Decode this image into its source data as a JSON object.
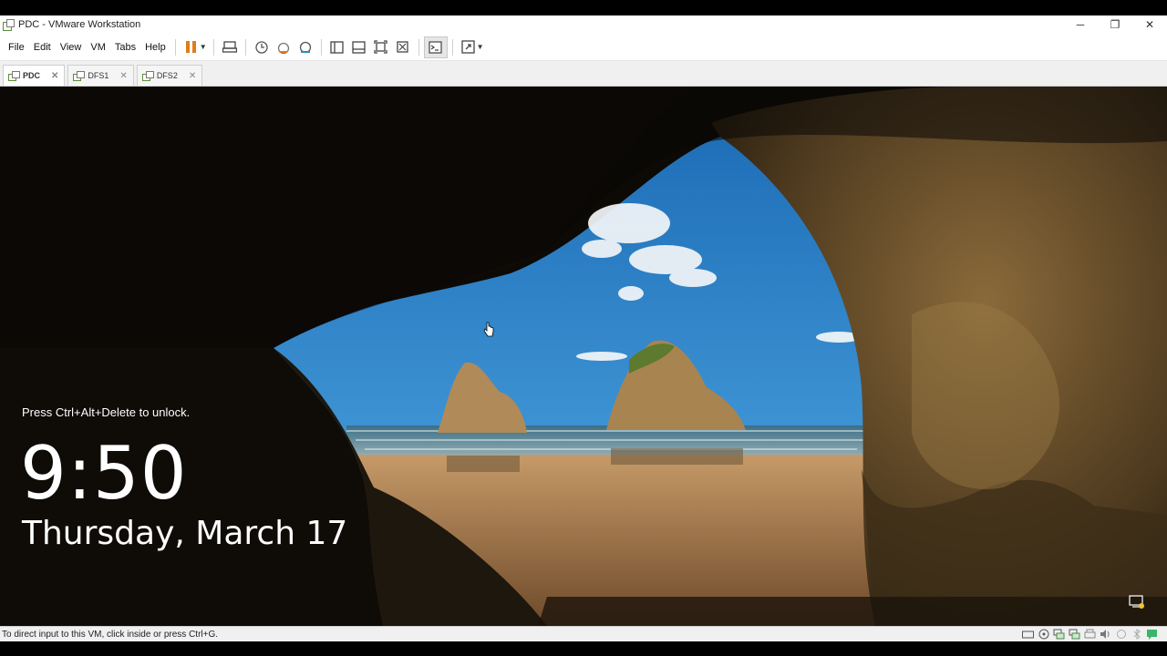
{
  "window": {
    "title": "PDC - VMware Workstation",
    "controls": {
      "minimize": "─",
      "restore": "❐",
      "close": "✕"
    }
  },
  "menu": {
    "items": [
      "File",
      "Edit",
      "View",
      "VM",
      "Tabs",
      "Help"
    ]
  },
  "toolbar": {
    "icons": [
      "pause-icon",
      "send-ctrl-alt-del-icon",
      "snapshot-icon",
      "revert-snapshot-icon",
      "snapshot-manager-icon",
      "library-icon",
      "thumbnail-bar-icon",
      "full-screen-icon",
      "unity-icon",
      "console-view-icon",
      "stretch-guest-icon"
    ]
  },
  "tabs": [
    {
      "label": "PDC",
      "active": true
    },
    {
      "label": "DFS1",
      "active": false
    },
    {
      "label": "DFS2",
      "active": false
    }
  ],
  "lockscreen": {
    "unlock_hint": "Press Ctrl+Alt+Delete to unlock.",
    "time": "9:50",
    "date": "Thursday, March 17"
  },
  "status": {
    "message": "To direct input to this VM, click inside or press Ctrl+G.",
    "device_icons": [
      "hard-disk-icon",
      "cd-icon",
      "network-icon",
      "network2-icon",
      "printer-icon",
      "sound-icon",
      "usb-icon",
      "bluetooth-icon",
      "message-icon"
    ]
  },
  "colors": {
    "pause": "#e07b1a",
    "sky": "#2b7fc4",
    "sand": "#b5895a"
  }
}
